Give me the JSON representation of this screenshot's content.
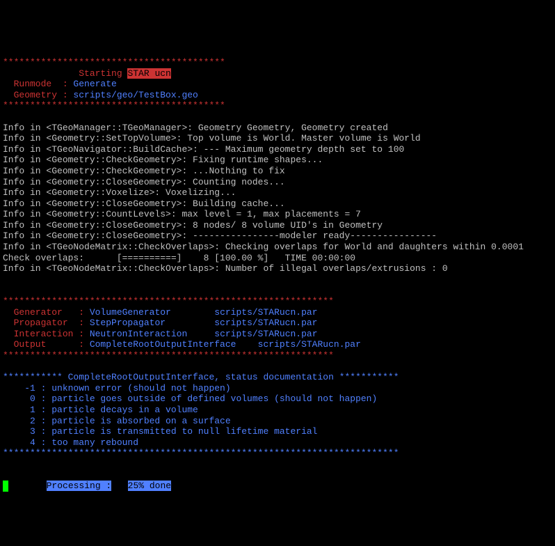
{
  "header": {
    "stars1": "*****************************************",
    "starting": "              Starting ",
    "starucn": "STAR ucn",
    "runmode_lbl": "  Runmode  : ",
    "runmode_val": "Generate",
    "geometry_lbl": "  Geometry : ",
    "geometry_val": "scripts/geo/TestBox.geo",
    "stars2": "*****************************************"
  },
  "info": {
    "l1": "Info in <TGeoManager::TGeoManager>: Geometry Geometry, Geometry created",
    "l2": "Info in <Geometry::SetTopVolume>: Top volume is World. Master volume is World",
    "l3": "Info in <TGeoNavigator::BuildCache>: --- Maximum geometry depth set to 100",
    "l4": "Info in <Geometry::CheckGeometry>: Fixing runtime shapes...",
    "l5": "Info in <Geometry::CheckGeometry>: ...Nothing to fix",
    "l6": "Info in <Geometry::CloseGeometry>: Counting nodes...",
    "l7": "Info in <Geometry::Voxelize>: Voxelizing...",
    "l8": "Info in <Geometry::CloseGeometry>: Building cache...",
    "l9": "Info in <Geometry::CountLevels>: max level = 1, max placements = 7",
    "l10": "Info in <Geometry::CloseGeometry>: 8 nodes/ 8 volume UID's in Geometry",
    "l11": "Info in <Geometry::CloseGeometry>: ----------------modeler ready----------------",
    "l12": "Info in <TGeoNodeMatrix::CheckOverlaps>: Checking overlaps for World and daughters within 0.0001",
    "l13": "Check overlaps:      [==========]    8 [100.00 %]   TIME 00:00:00",
    "l14": "Info in <TGeoNodeMatrix::CheckOverlaps>: Number of illegal overlaps/extrusions : 0"
  },
  "config": {
    "stars1": "*************************************************************",
    "gen_lbl": "  Generator   : ",
    "gen_val": "VolumeGenerator",
    "gen_par": "        scripts/STARucn.par",
    "prop_lbl": "  Propagator  : ",
    "prop_val": "StepPropagator",
    "prop_par": "         scripts/STARucn.par",
    "int_lbl": "  Interaction : ",
    "int_val": "NeutronInteraction",
    "int_par": "     scripts/STARucn.par",
    "out_lbl": "  Output      : ",
    "out_val": "CompleteRootOutputInterface",
    "out_par": "    scripts/STARucn.par",
    "stars2": "*************************************************************"
  },
  "status": {
    "header_stars1": "*********** ",
    "header_text": "CompleteRootOutputInterface, status documentation",
    "header_stars2": " ***********",
    "cm1": "    -1 : unknown error (should not happen)",
    "c0": "     0 : particle goes outside of defined volumes (should not happen)",
    "c1": "     1 : particle decays in a volume",
    "c2": "     2 : particle is absorbed on a surface",
    "c3": "     3 : particle is transmitted to null lifetime material",
    "c4": "     4 : too many rebound",
    "stars": "*************************************************************************"
  },
  "progress": {
    "cursor": " ",
    "prefix": "       ",
    "label": "Processing :",
    "mid": "   ",
    "pct": "25%",
    "suffix": " done"
  }
}
